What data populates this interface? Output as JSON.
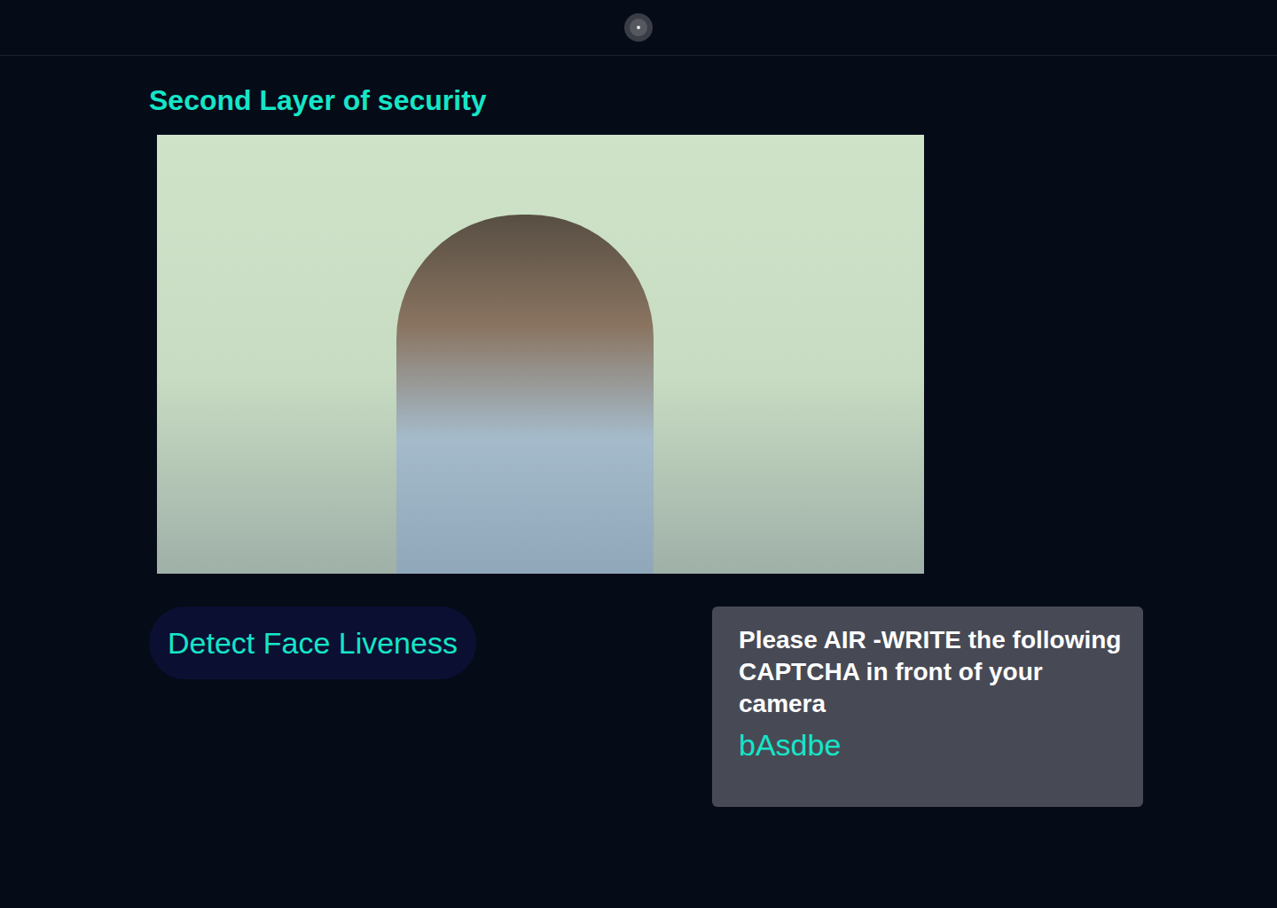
{
  "page": {
    "title": "Second Layer of security"
  },
  "liveness_button": {
    "label": "Detect Face Liveness"
  },
  "captcha": {
    "prompt": "Please AIR -WRITE the following CAPTCHA in front of your camera",
    "code": "bAsdbe"
  }
}
